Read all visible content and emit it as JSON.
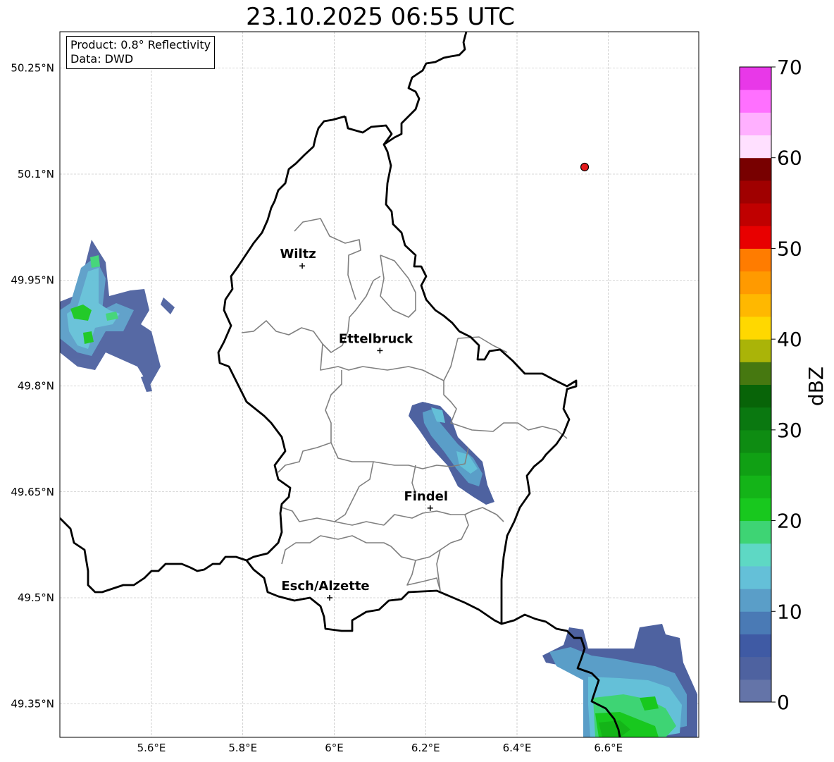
{
  "title": "23.10.2025 06:55 UTC",
  "info": {
    "product": "Product: 0.8° Reflectivity",
    "data": "Data: DWD"
  },
  "lat_ticks": [
    {
      "value": 50.25,
      "label": "50.25°N"
    },
    {
      "value": 50.1,
      "label": "50.1°N"
    },
    {
      "value": 49.95,
      "label": "49.95°N"
    },
    {
      "value": 49.8,
      "label": "49.8°N"
    },
    {
      "value": 49.65,
      "label": "49.65°N"
    },
    {
      "value": 49.5,
      "label": "49.5°N"
    },
    {
      "value": 49.35,
      "label": "49.35°N"
    }
  ],
  "lon_ticks": [
    {
      "value": 5.6,
      "label": "5.6°E"
    },
    {
      "value": 5.8,
      "label": "5.8°E"
    },
    {
      "value": 6.0,
      "label": "6°E"
    },
    {
      "value": 6.2,
      "label": "6.2°E"
    },
    {
      "value": 6.4,
      "label": "6.4°E"
    },
    {
      "value": 6.6,
      "label": "6.6°E"
    }
  ],
  "cities": [
    {
      "name": "Wiltz",
      "lon": 5.93,
      "lat": 49.97
    },
    {
      "name": "Ettelbruck",
      "lon": 6.1,
      "lat": 49.85
    },
    {
      "name": "Findel",
      "lon": 6.21,
      "lat": 49.627
    },
    {
      "name": "Esch/Alzette",
      "lon": 5.99,
      "lat": 49.5
    }
  ],
  "radar_site": {
    "lon": 6.548,
    "lat": 50.11,
    "color": "#e31a1c"
  },
  "colorbar": {
    "label": "dBZ",
    "min": 0,
    "max": 70,
    "step": 2.5,
    "tick_values": [
      0,
      10,
      20,
      30,
      40,
      50,
      60,
      70
    ],
    "tick_labels": [
      "0",
      "10",
      "20",
      "30",
      "40",
      "50",
      "60",
      "70"
    ],
    "colors": [
      "#6474a8",
      "#4e62a0",
      "#3f5aa4",
      "#4a7ab5",
      "#5a9ec8",
      "#64c0d8",
      "#5ed8c4",
      "#3ed474",
      "#18c81e",
      "#14b418",
      "#10a014",
      "#0e8c12",
      "#0a7810",
      "#086408",
      "#467810",
      "#aab408",
      "#ffd800",
      "#ffb800",
      "#ff9a00",
      "#ff7c00",
      "#e80000",
      "#c00000",
      "#a00000",
      "#780000",
      "#ffe0ff",
      "#ffb0ff",
      "#ff70ff",
      "#e838e8"
    ]
  },
  "colors": {
    "country_border": "#000000",
    "canton_border": "#808080",
    "grid": "#b0b0b0"
  }
}
